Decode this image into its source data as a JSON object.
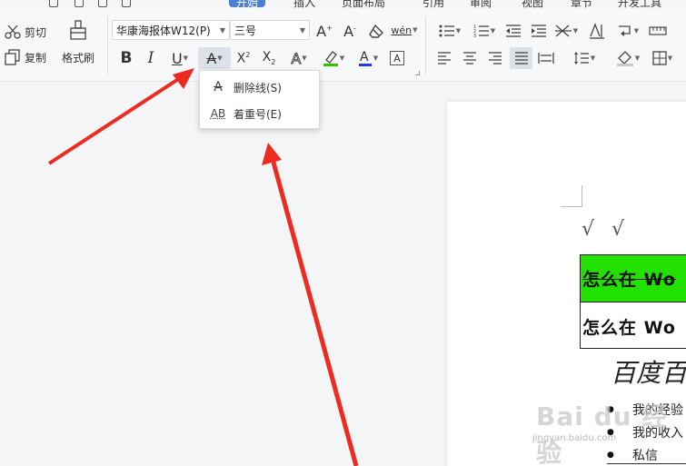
{
  "tabs": {
    "start": "开始",
    "insert": "插入",
    "layout": "页面布局",
    "reference": "引用",
    "review": "审阅",
    "view": "视图",
    "chapter": "章节",
    "developer": "开发工具"
  },
  "clipboard": {
    "cut_label": "剪切",
    "copy_label": "复制",
    "format_painter_label": "格式刷"
  },
  "font": {
    "name": "华康海报体W12(P)",
    "size": "三号",
    "phonetic_glyph": "wén",
    "strikethrough_dropdown": {
      "items": [
        {
          "label": "删除线(S)",
          "icon": "strikethrough-icon"
        },
        {
          "label": "着重号(E)",
          "icon": "emphasis-mark-icon"
        }
      ]
    }
  },
  "colors": {
    "highlight": "#2fc500",
    "font_color": "#1f3fd6",
    "table_row_fill": "#22e000",
    "arrow": "#ee2b20"
  },
  "document": {
    "sqrt_symbols": "√ √",
    "table_rows": [
      "怎么在 Wo",
      "怎么在 Wo"
    ],
    "heading": "百度百",
    "bullets": [
      "我的经验",
      "我的收入",
      "私信"
    ]
  },
  "watermark": {
    "brand": "Bai du 经验",
    "url": "jingyan.baidu.com"
  }
}
